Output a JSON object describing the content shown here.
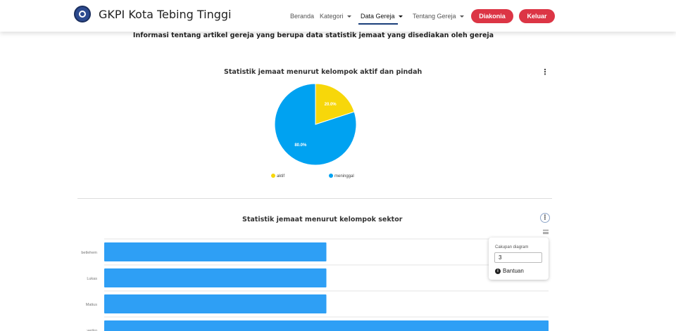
{
  "header": {
    "brand": "GKPI Kota Tebing Tinggi",
    "nav": [
      {
        "label": "Beranda"
      },
      {
        "label": "Kategori"
      },
      {
        "label": "Data Gereja"
      },
      {
        "label": "Tentang Gereja"
      }
    ],
    "buttons": {
      "diakonia": "Diakonia",
      "keluar": "Keluar"
    },
    "active_nav": "Data Gereja"
  },
  "page": {
    "subtitle": "Informasi tentang artikel gereja yang berupa data statistik jemaat yang disediakan oleh gereja"
  },
  "pie_card": {
    "menu_glyph": "⋮"
  },
  "bar_card": {
    "menu_glyph": "⋮"
  },
  "popup": {
    "label": "Cakupan diagram",
    "value": "3",
    "help_icon": "info-icon",
    "help_label": "Bantuan"
  },
  "chart_data": [
    {
      "type": "pie",
      "title": "Statistik jemaat menurut kelompok aktif dan pindah",
      "categories": [
        "aktif",
        "meninggal"
      ],
      "values": [
        20.0,
        80.0
      ],
      "data_labels": [
        "20.0%",
        "80.0%"
      ],
      "colors": [
        "#f7d70a",
        "#00a2f1"
      ],
      "legend_placement": "bottom"
    },
    {
      "type": "bar",
      "orientation": "horizontal",
      "title": "Statistik jemaat menurut kelompok sektor",
      "categories": [
        "betlehem",
        "Lukas",
        "Matius",
        "yeriko"
      ],
      "values": [
        1,
        1,
        1,
        2
      ],
      "xlim": [
        0,
        2
      ],
      "color": "#2e9ff5",
      "grid": true
    }
  ],
  "colors": {
    "accent_red": "#dc3545",
    "nav_underline": "#1a3f7a"
  }
}
